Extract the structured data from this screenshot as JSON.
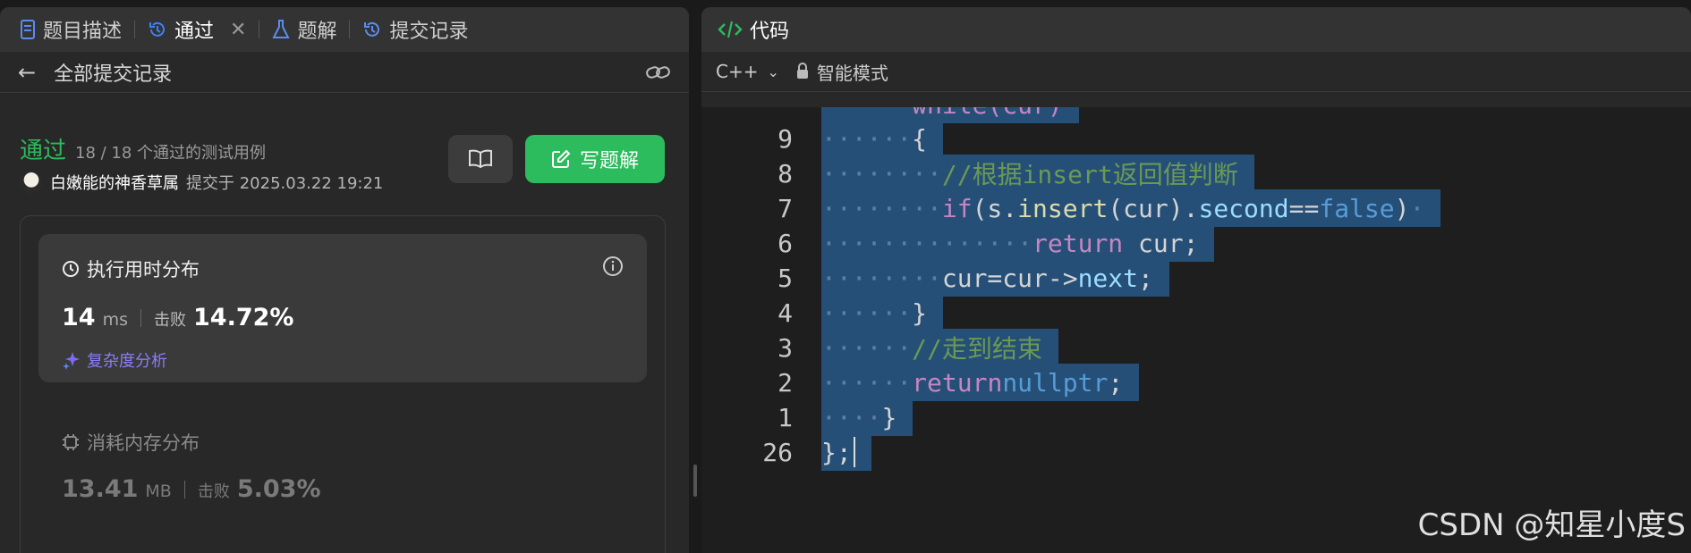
{
  "left_tabs": {
    "description": "题目描述",
    "passed": "通过",
    "solutions": "题解",
    "submissions": "提交记录"
  },
  "sub_header": {
    "title": "全部提交记录"
  },
  "result": {
    "status": "通过",
    "cases": "18 / 18 个通过的测试用例",
    "author": "白嫩能的神香草属",
    "submitted_at": "提交于 2025.03.22 19:21",
    "write_solution_label": "写题解"
  },
  "runtime": {
    "title": "执行用时分布",
    "value": "14",
    "unit": "ms",
    "beat_label": "击败",
    "beat_value": "14.72%",
    "complexity_label": "复杂度分析"
  },
  "memory": {
    "title": "消耗内存分布",
    "value": "13.41",
    "unit": "MB",
    "beat_label": "击败",
    "beat_value": "5.03%"
  },
  "code_panel": {
    "tab_label": "代码",
    "language": "C++",
    "mode": "智能模式"
  },
  "code_lines": [
    {
      "num": "9",
      "indent": "······",
      "html": "{"
    },
    {
      "num": "8",
      "indent": "········",
      "html": "<span class='cm'>//根据insert返回值判断</span>"
    },
    {
      "num": "7",
      "indent": "········",
      "html": "<span class='kw'>if</span>(s.<span class='fn'>insert</span>(cur).<span class='pr'>second</span>==<span class='bl'>false</span>)<span class='dots'>·</span>"
    },
    {
      "num": "6",
      "indent": "··············",
      "html": "<span class='kw'>return</span> cur;"
    },
    {
      "num": "5",
      "indent": "········",
      "html": "cur=cur-><span class='pr'>next</span>;"
    },
    {
      "num": "4",
      "indent": "······",
      "html": "}"
    },
    {
      "num": "3",
      "indent": "······",
      "html": "<span class='cm'>//走到结束</span>"
    },
    {
      "num": "2",
      "indent": "······",
      "html": "<span class='kw'>return</span> <span class='bl'>nullptr</span>;"
    },
    {
      "num": "1",
      "indent": "····",
      "html": "}"
    },
    {
      "num": "26",
      "indent": "",
      "html": "};"
    }
  ],
  "partial_top_line": "while(cur)",
  "watermark": "CSDN @知星小度S"
}
